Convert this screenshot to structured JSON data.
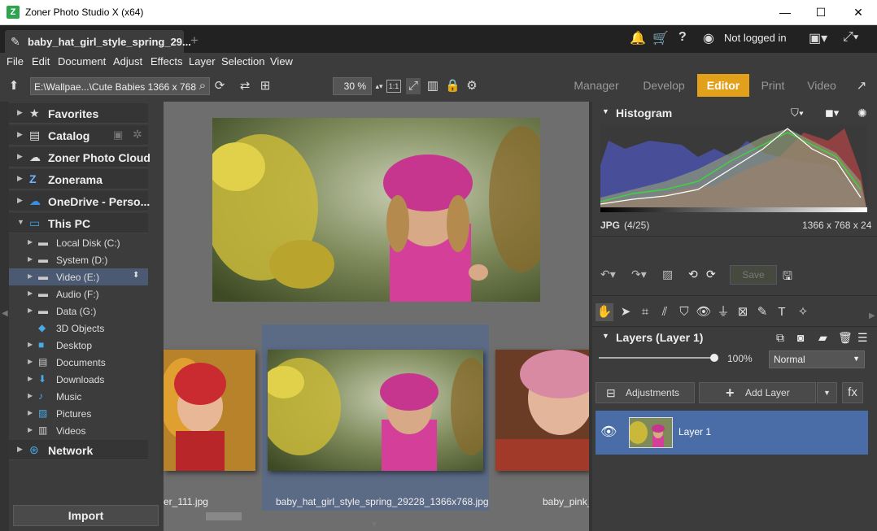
{
  "window": {
    "title": "Zoner Photo Studio X (x64)",
    "app_icon": "ZPS"
  },
  "tabbar": {
    "doc_tab_label": "baby_hat_girl_style_spring_29...",
    "add_tab": "+",
    "login_label": "Not logged in"
  },
  "menu": [
    "File",
    "Edit",
    "Document",
    "Adjust",
    "Effects",
    "Layer",
    "Selection",
    "View"
  ],
  "toolbar": {
    "path": "E:\\Wallpae...\\Cute Babies 1366 x  768",
    "zoom": "30 %",
    "modes": [
      "Manager",
      "Develop",
      "Editor",
      "Print",
      "Video"
    ],
    "active_mode": "Editor",
    "fit_label": "1:1"
  },
  "nav": {
    "top": [
      {
        "label": "Favorites",
        "icon": "star-icon",
        "glyph": "★"
      },
      {
        "label": "Catalog",
        "icon": "catalog-icon",
        "glyph": "▤"
      },
      {
        "label": "Zoner Photo Cloud",
        "icon": "cloud-icon",
        "glyph": "☁"
      },
      {
        "label": "Zonerama",
        "icon": "zonerama-icon",
        "glyph": "Z"
      },
      {
        "label": "OneDrive - Perso...",
        "icon": "onedrive-icon",
        "glyph": "☁"
      },
      {
        "label": "This PC",
        "icon": "computer-icon",
        "glyph": "▭"
      }
    ],
    "pc_items": [
      {
        "label": "Local Disk (C:)"
      },
      {
        "label": "System (D:)"
      },
      {
        "label": "Video (E:)"
      },
      {
        "label": "Audio (F:)"
      },
      {
        "label": "Data (G:)"
      },
      {
        "label": "3D Objects"
      },
      {
        "label": "Desktop"
      },
      {
        "label": "Documents"
      },
      {
        "label": "Downloads"
      },
      {
        "label": "Music"
      },
      {
        "label": "Pictures"
      },
      {
        "label": "Videos"
      }
    ],
    "network": "Network",
    "import": "Import"
  },
  "thumbs": {
    "left_caption": "er_111.jpg",
    "selected_caption": "baby_hat_girl_style_spring_29228_1366x768.jpg",
    "right_caption": "baby_pink_"
  },
  "right": {
    "histogram_title": "Histogram",
    "format": "JPG",
    "index": "(4/25)",
    "dimensions": "1366 x 768 x 24",
    "save_label": "Save",
    "layers_title": "Layers (Layer 1)",
    "opacity": "100%",
    "blend_mode": "Normal",
    "adjustments_label": "Adjustments",
    "add_layer_label": "Add Layer",
    "fx_label": "fx",
    "layer_name": "Layer 1"
  },
  "colors": {
    "accent": "#e3a11b",
    "selection": "#4a6da7",
    "background": "#3c3c3c"
  }
}
